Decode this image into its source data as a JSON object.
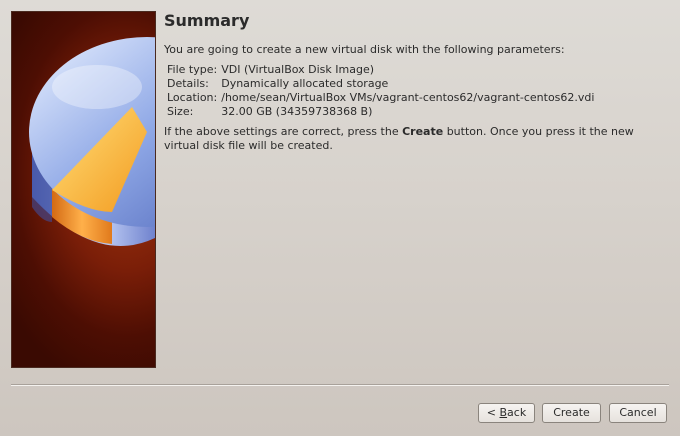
{
  "wizard": {
    "title": "Summary",
    "intro": "You are going to create a new virtual disk with the following parameters:",
    "parameters": [
      {
        "label": "File type:",
        "value": "VDI (VirtualBox Disk Image)"
      },
      {
        "label": "Details:",
        "value": "Dynamically allocated storage"
      },
      {
        "label": "Location:",
        "value": "/home/sean/VirtualBox VMs/vagrant-centos62/vagrant-centos62.vdi"
      },
      {
        "label": "Size:",
        "value": "32.00 GB (34359738368 B)"
      }
    ],
    "outro_before": "If the above settings are correct, press the ",
    "outro_bold": "Create",
    "outro_after": " button. Once you press it the new virtual disk file will be created."
  },
  "buttons": {
    "back_arrow": "< ",
    "back_mnemonic": "B",
    "back_rest": "ack",
    "create": "Create",
    "cancel": "Cancel"
  },
  "side_image": {
    "icon": "hard-disk-pie-chart-icon",
    "background_color": "#6e1a06"
  }
}
